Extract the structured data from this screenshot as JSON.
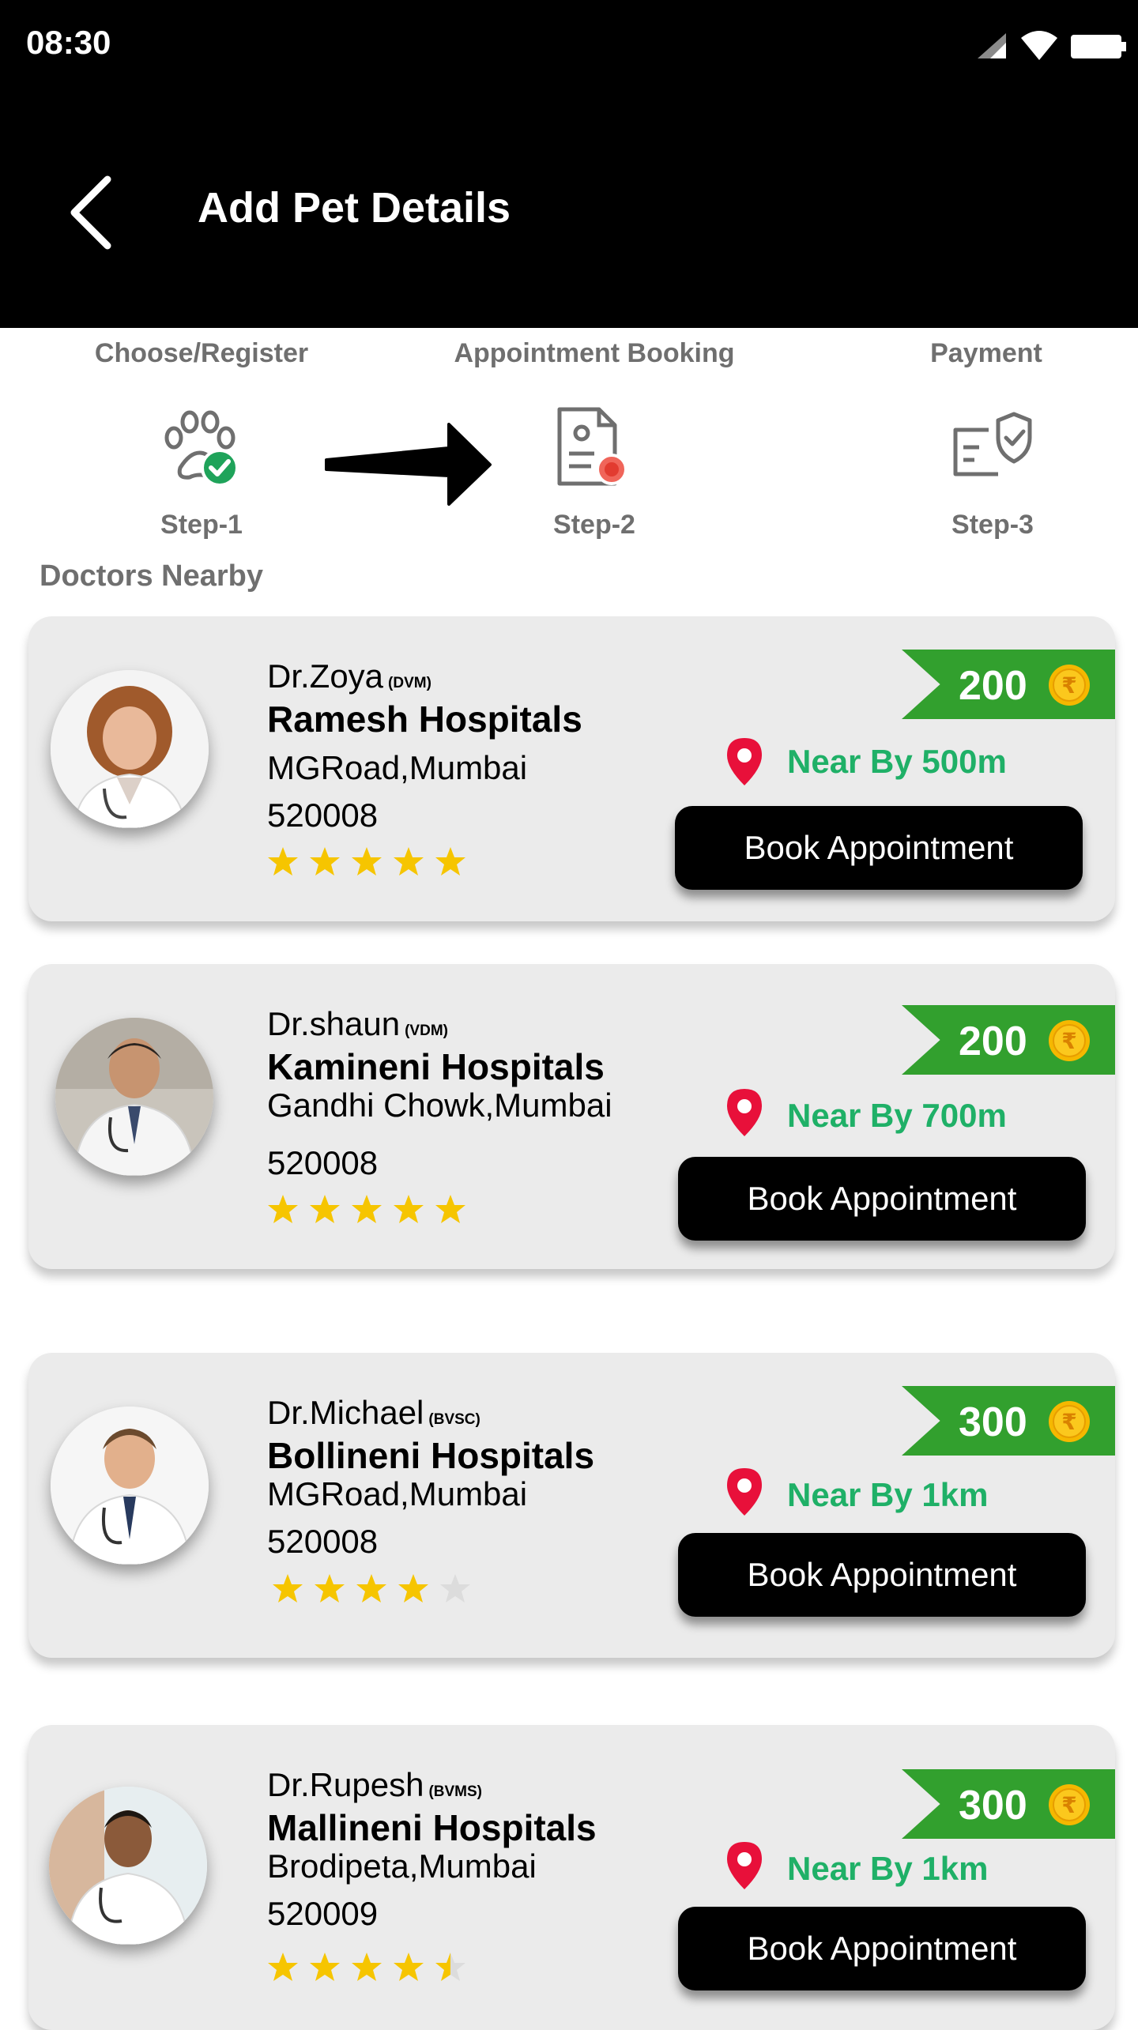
{
  "status_bar": {
    "time": "08:30"
  },
  "header": {
    "title": "Add Pet Details"
  },
  "steps": [
    {
      "label": "Choose/Register",
      "sub": "Step-1"
    },
    {
      "label": "Appointment Booking",
      "sub": "Step-2"
    },
    {
      "label": "Payment",
      "sub": "Step-3"
    }
  ],
  "section_title": "Doctors Nearby",
  "doctors": [
    {
      "name": "Dr.Zoya",
      "qualification": "(DVM)",
      "hospital": "Ramesh Hospitals",
      "address": "MGRoad,Mumbai",
      "pincode": "520008",
      "rating": 5,
      "price": "200",
      "distance": "Near By 500m",
      "button": "Book Appointment"
    },
    {
      "name": "Dr.shaun",
      "qualification": "(VDM)",
      "hospital": "Kamineni Hospitals",
      "address": "Gandhi Chowk,Mumbai",
      "pincode": "520008",
      "rating": 5,
      "price": "200",
      "distance": "Near By 700m",
      "button": "Book Appointment"
    },
    {
      "name": "Dr.Michael",
      "qualification": "(BVSC)",
      "hospital": "Bollineni Hospitals",
      "address": "MGRoad,Mumbai",
      "pincode": "520008",
      "rating": 4,
      "price": "300",
      "distance": "Near By 1km",
      "button": "Book Appointment"
    },
    {
      "name": "Dr.Rupesh",
      "qualification": "(BVMS)",
      "hospital": "Mallineni Hospitals",
      "address": "Brodipeta,Mumbai",
      "pincode": "520009",
      "rating": 4.5,
      "price": "300",
      "distance": "Near By 1km",
      "button": "Book Appointment"
    }
  ],
  "colors": {
    "accent_green": "#32a02e",
    "distance_text": "#1fb067",
    "pin_red": "#e8103a",
    "star": "#f6c500",
    "coin": "#f5b800"
  },
  "icons": [
    "back-arrow-icon",
    "signal-icon",
    "wifi-icon",
    "battery-icon",
    "paw-check-icon",
    "arrow-right-icon",
    "document-record-icon",
    "verified-card-icon",
    "location-pin-icon",
    "rupee-coin-icon",
    "star-icon"
  ]
}
